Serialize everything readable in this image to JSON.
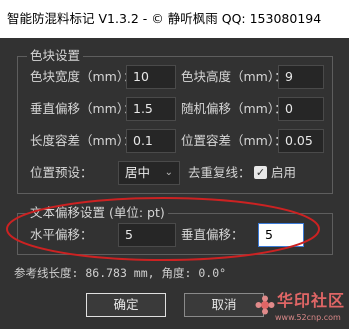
{
  "window": {
    "title": "智能防混料标记 V1.3.2 - © 静听枫雨 QQ: 153080194"
  },
  "color_block_group": {
    "title": "色块设置",
    "width_label": "色块宽度（mm）：",
    "width_value": "10",
    "height_label": "色块高度（mm）：",
    "height_value": "9",
    "vertical_offset_label": "垂直偏移（mm）：",
    "vertical_offset_value": "1.5",
    "random_offset_label": "随机偏移（mm）：",
    "random_offset_value": "0",
    "length_tolerance_label": "长度容差（mm）：",
    "length_tolerance_value": "0.1",
    "position_tolerance_label": "位置容差（mm）：",
    "position_tolerance_value": "0.05",
    "position_preset_label": "位置预设：",
    "position_preset_value": "居中",
    "dedup_label": "去重复线：",
    "dedup_checked": true,
    "dedup_checkbox_label": "启用"
  },
  "text_offset_group": {
    "title": "文本偏移设置 (单位: pt)",
    "horizontal_label": "水平偏移：",
    "horizontal_value": "5",
    "vertical_label": "垂直偏移：",
    "vertical_value": "5"
  },
  "info_line": "参考线长度: 86.783 mm, 角度: 0.0°",
  "buttons": {
    "ok_label": "确定",
    "cancel_label": "取消"
  },
  "watermark": {
    "text": "华印社区",
    "url": "www.52cnp.com"
  },
  "colors": {
    "background": "#323232",
    "titlebar": "#ffffff",
    "annotation": "#cc2222",
    "watermark": "#e06666"
  },
  "icons": {
    "dropdown": "chevron-down-icon",
    "checkbox": "checkmark-icon",
    "watermark_logo": "flower-logo-icon"
  }
}
